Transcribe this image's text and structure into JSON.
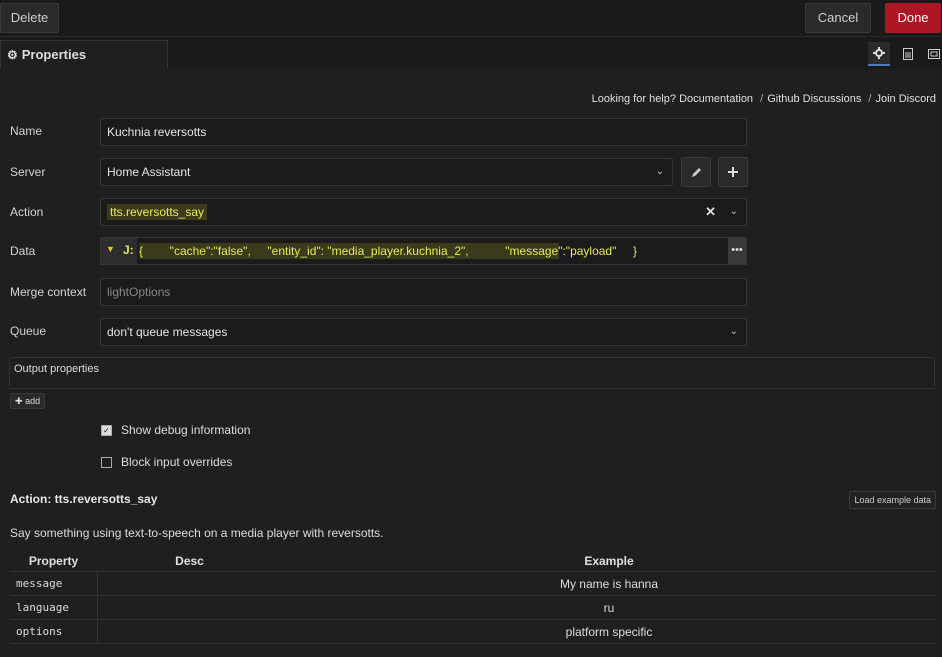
{
  "toolbar": {
    "delete_label": "Delete",
    "cancel_label": "Cancel",
    "done_label": "Done"
  },
  "tabs": {
    "properties_label": "Properties",
    "icons": [
      "gear-icon",
      "document-icon",
      "layout-icon"
    ]
  },
  "help": {
    "prefix": "Looking for help?",
    "links": [
      "Documentation",
      "Github Discussions",
      "Join Discord"
    ],
    "separator": "/"
  },
  "form": {
    "name": {
      "label": "Name",
      "value": "Kuchnia reversotts"
    },
    "server": {
      "label": "Server",
      "value": "Home Assistant"
    },
    "action": {
      "label": "Action",
      "value": "tts.reversotts_say"
    },
    "data": {
      "label": "Data",
      "type_glyph": "J:",
      "value": "{        \"cache\":\"false\",     \"entity_id\": \"media_player.kuchnia_2\",           \"message\":\"payload\"     }"
    },
    "merge_context": {
      "label": "Merge context",
      "placeholder": "lightOptions"
    },
    "queue": {
      "label": "Queue",
      "value": "don't queue messages"
    },
    "output_properties": {
      "label": "Output properties",
      "add_label": "add"
    },
    "show_debug": {
      "label": "Show debug information",
      "checked": true
    },
    "block_input": {
      "label": "Block input overrides",
      "checked": false
    }
  },
  "action_info": {
    "title": "Action: tts.reversotts_say",
    "load_example_label": "Load example data",
    "description": "Say something using text-to-speech on a media player with reversotts.",
    "columns": [
      "Property",
      "Desc",
      "Example"
    ],
    "rows": [
      {
        "property": "message",
        "desc": "",
        "example": "My name is hanna"
      },
      {
        "property": "language",
        "desc": "",
        "example": "ru"
      },
      {
        "property": "options",
        "desc": "",
        "example": "platform specific"
      }
    ]
  },
  "colors": {
    "accent_done": "#ad1625",
    "highlight_text": "#e8e859",
    "background": "#1f1f1f"
  }
}
